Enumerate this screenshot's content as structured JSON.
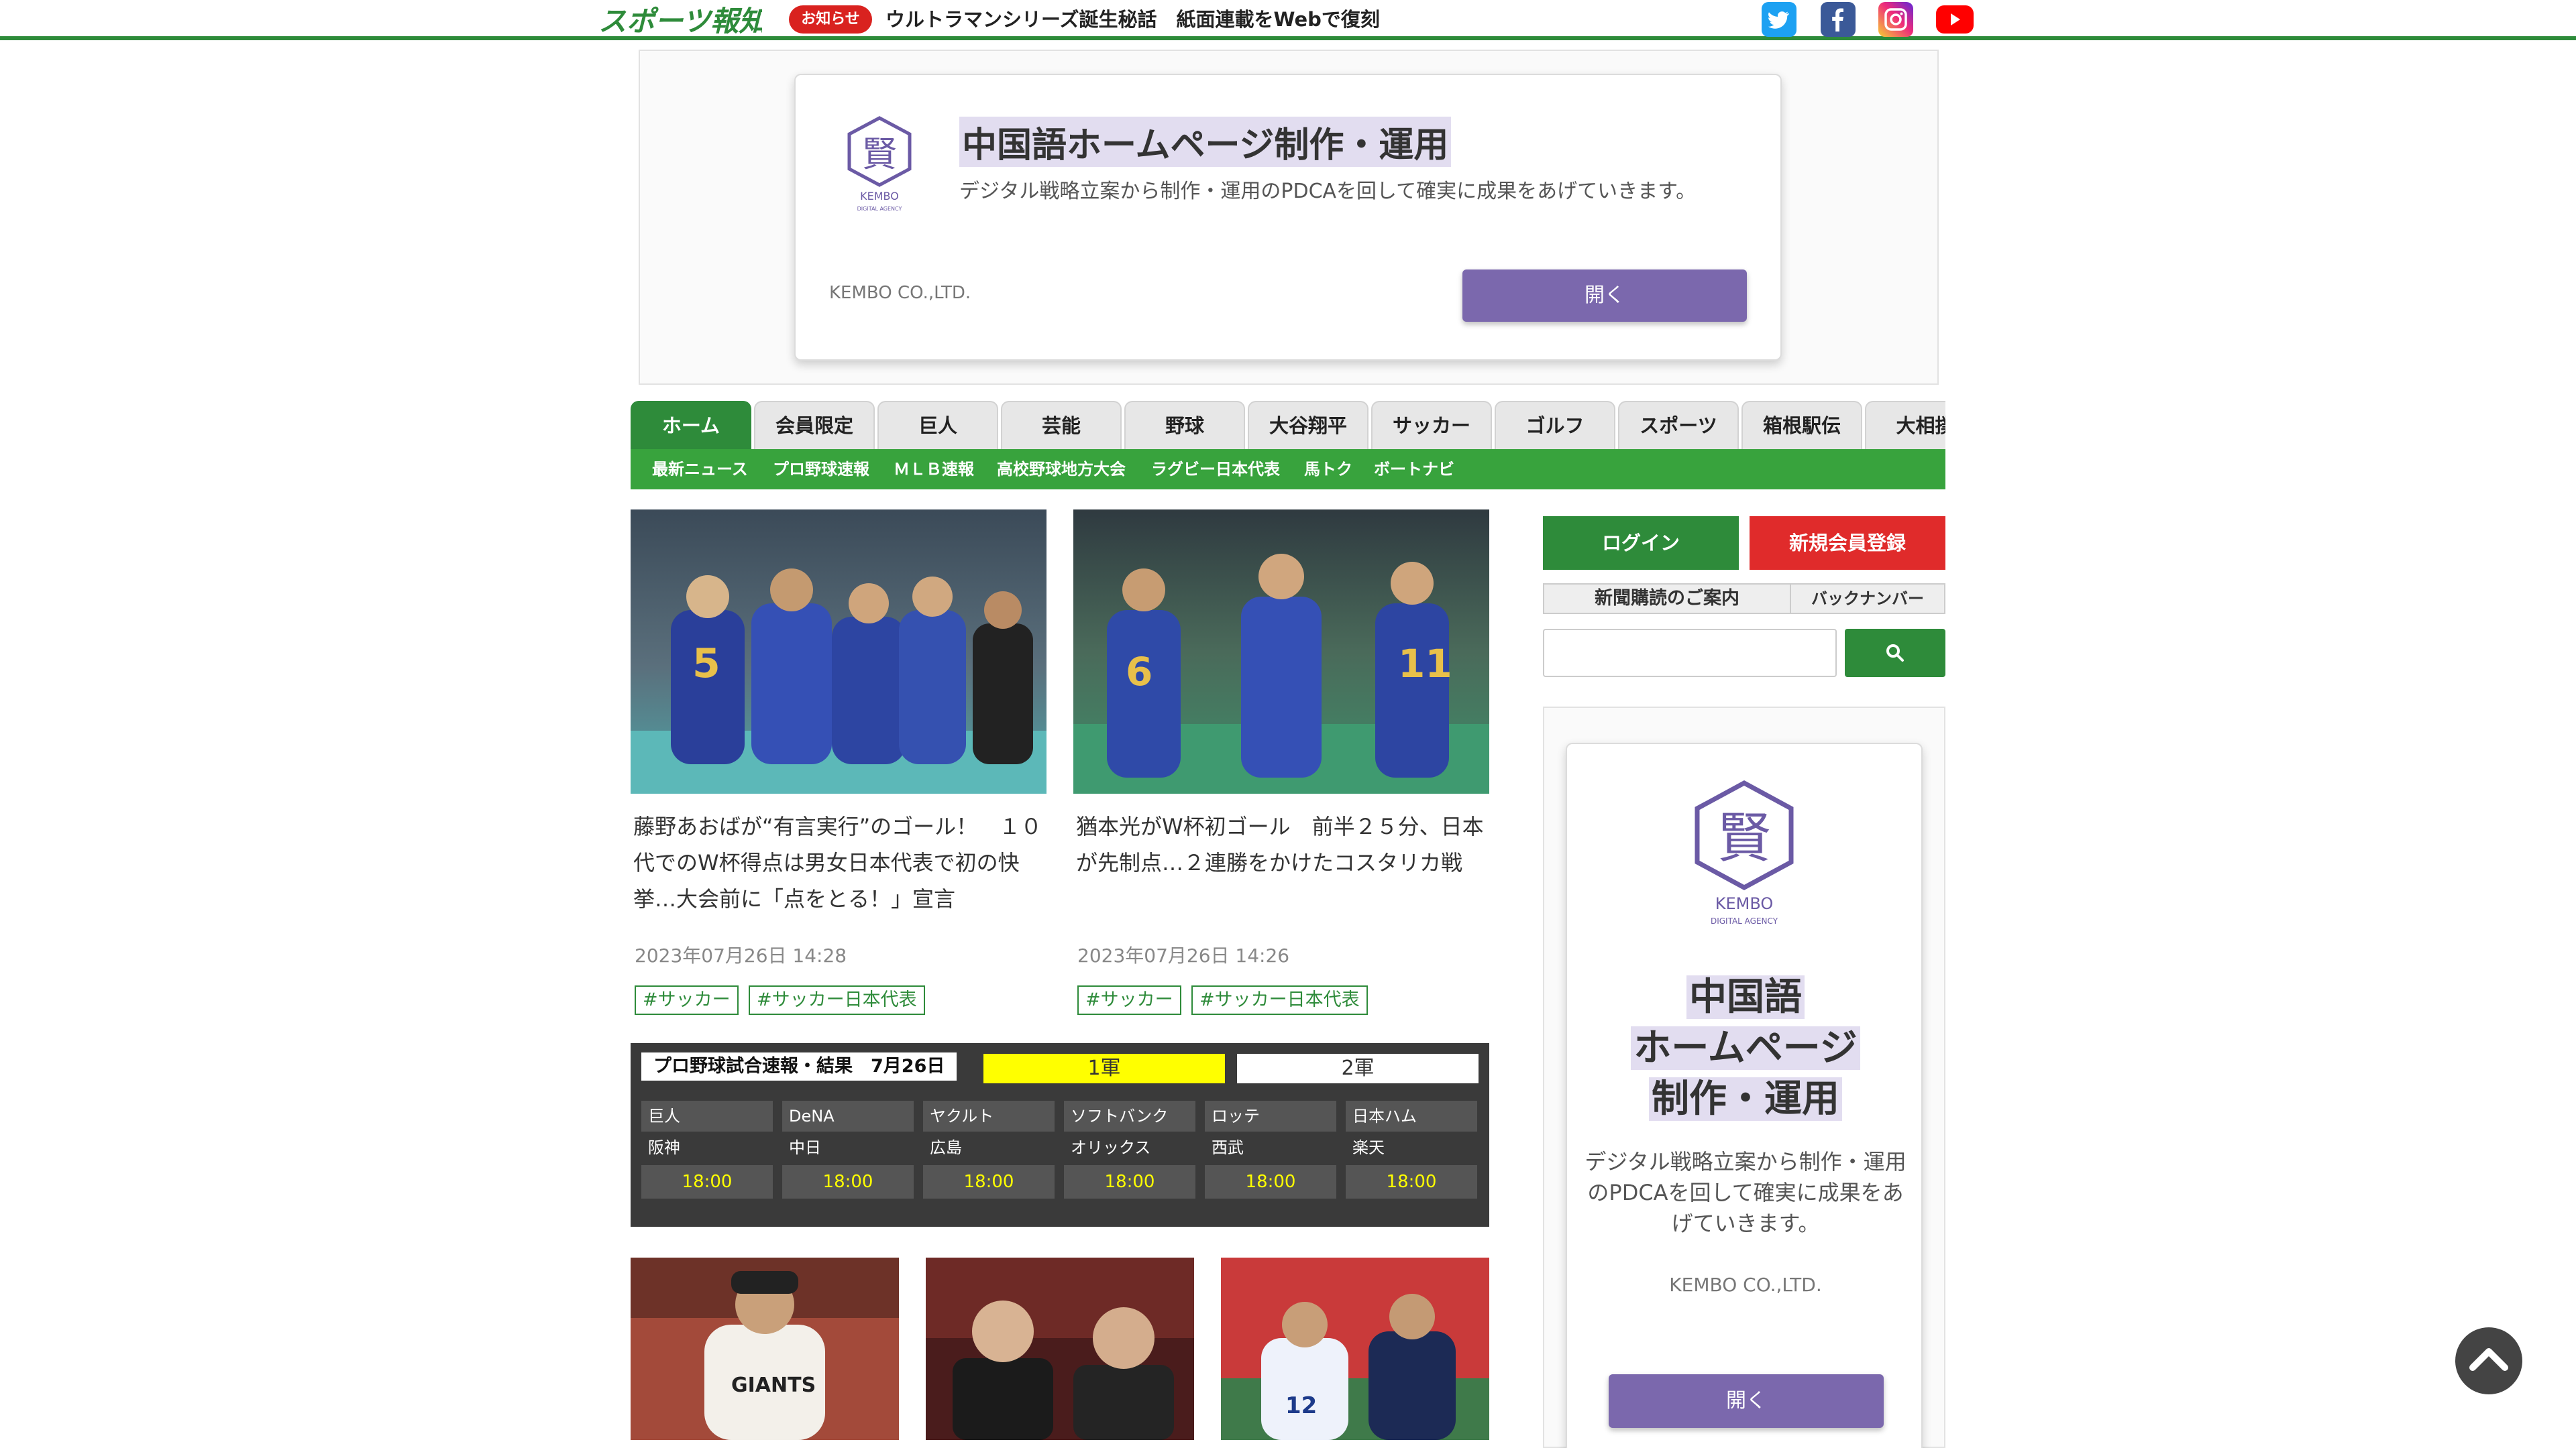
{
  "header": {
    "logo_text": "スポーツ報知",
    "notice_badge": "お知らせ",
    "notice_text": "ウルトラマンシリーズ誕生秘話　紙面連載をWebで復刻",
    "social_icons": [
      "twitter-icon",
      "facebook-icon",
      "instagram-icon",
      "youtube-icon"
    ],
    "accent_color": "#2e8b3a"
  },
  "top_ad": {
    "brand_mark": "KEMBO",
    "brand_sub": "DIGITAL AGENCY",
    "title": "中国語ホームページ制作・運用",
    "description": "デジタル戦略立案から制作・運用のPDCAを回して確実に成果をあげていきます。",
    "company": "KEMBO CO.,LTD.",
    "open_label": "開く"
  },
  "nav": {
    "tabs": [
      "ホーム",
      "会員限定",
      "巨人",
      "芸能",
      "野球",
      "大谷翔平",
      "サッカー",
      "ゴルフ",
      "スポーツ",
      "箱根駅伝",
      "大相撲"
    ],
    "active_tab": "ホーム",
    "subnav": [
      "最新ニュース",
      "プロ野球速報",
      "ＭＬＢ速報",
      "高校野球地方大会",
      "ラグビー日本代表",
      "馬トク",
      "ボートナビ"
    ]
  },
  "articles": [
    {
      "headline": "藤野あおばが“有言実行”のゴール！　１０代でのW杯得点は男女日本代表で初の快挙…大会前に「点をとる！」宣言",
      "timestamp": "2023年07月26日 14:28",
      "tags": [
        "#サッカー",
        "#サッカー日本代表"
      ]
    },
    {
      "headline": "猶本光がW杯初ゴール　前半２５分、日本が先制点…２連勝をかけたコスタリカ戦",
      "timestamp": "2023年07月26日 14:26",
      "tags": [
        "#サッカー",
        "#サッカー日本代表"
      ]
    }
  ],
  "scoreboard": {
    "title": "プロ野球試合速報・結果　7月26日",
    "tab_first": "1軍",
    "tab_second": "2軍",
    "games": [
      {
        "home": "巨人",
        "away": "阪神",
        "time": "18:00"
      },
      {
        "home": "DeNA",
        "away": "中日",
        "time": "18:00"
      },
      {
        "home": "ヤクルト",
        "away": "広島",
        "time": "18:00"
      },
      {
        "home": "ソフトバンク",
        "away": "オリックス",
        "time": "18:00"
      },
      {
        "home": "ロッテ",
        "away": "西武",
        "time": "18:00"
      },
      {
        "home": "日本ハム",
        "away": "楽天",
        "time": "18:00"
      }
    ]
  },
  "sidebar": {
    "login_label": "ログイン",
    "register_label": "新規会員登録",
    "subscribe_label": "新聞購読のご案内",
    "backnumber_label": "バックナンバー",
    "search_placeholder": "",
    "ad": {
      "title_lines": [
        "中国語",
        "ホームページ",
        "制作・運用"
      ],
      "description": "デジタル戦略立案から制作・運用のPDCAを回して確実に成果をあげていきます。",
      "company": "KEMBO CO.,LTD.",
      "open_label": "開く"
    }
  }
}
